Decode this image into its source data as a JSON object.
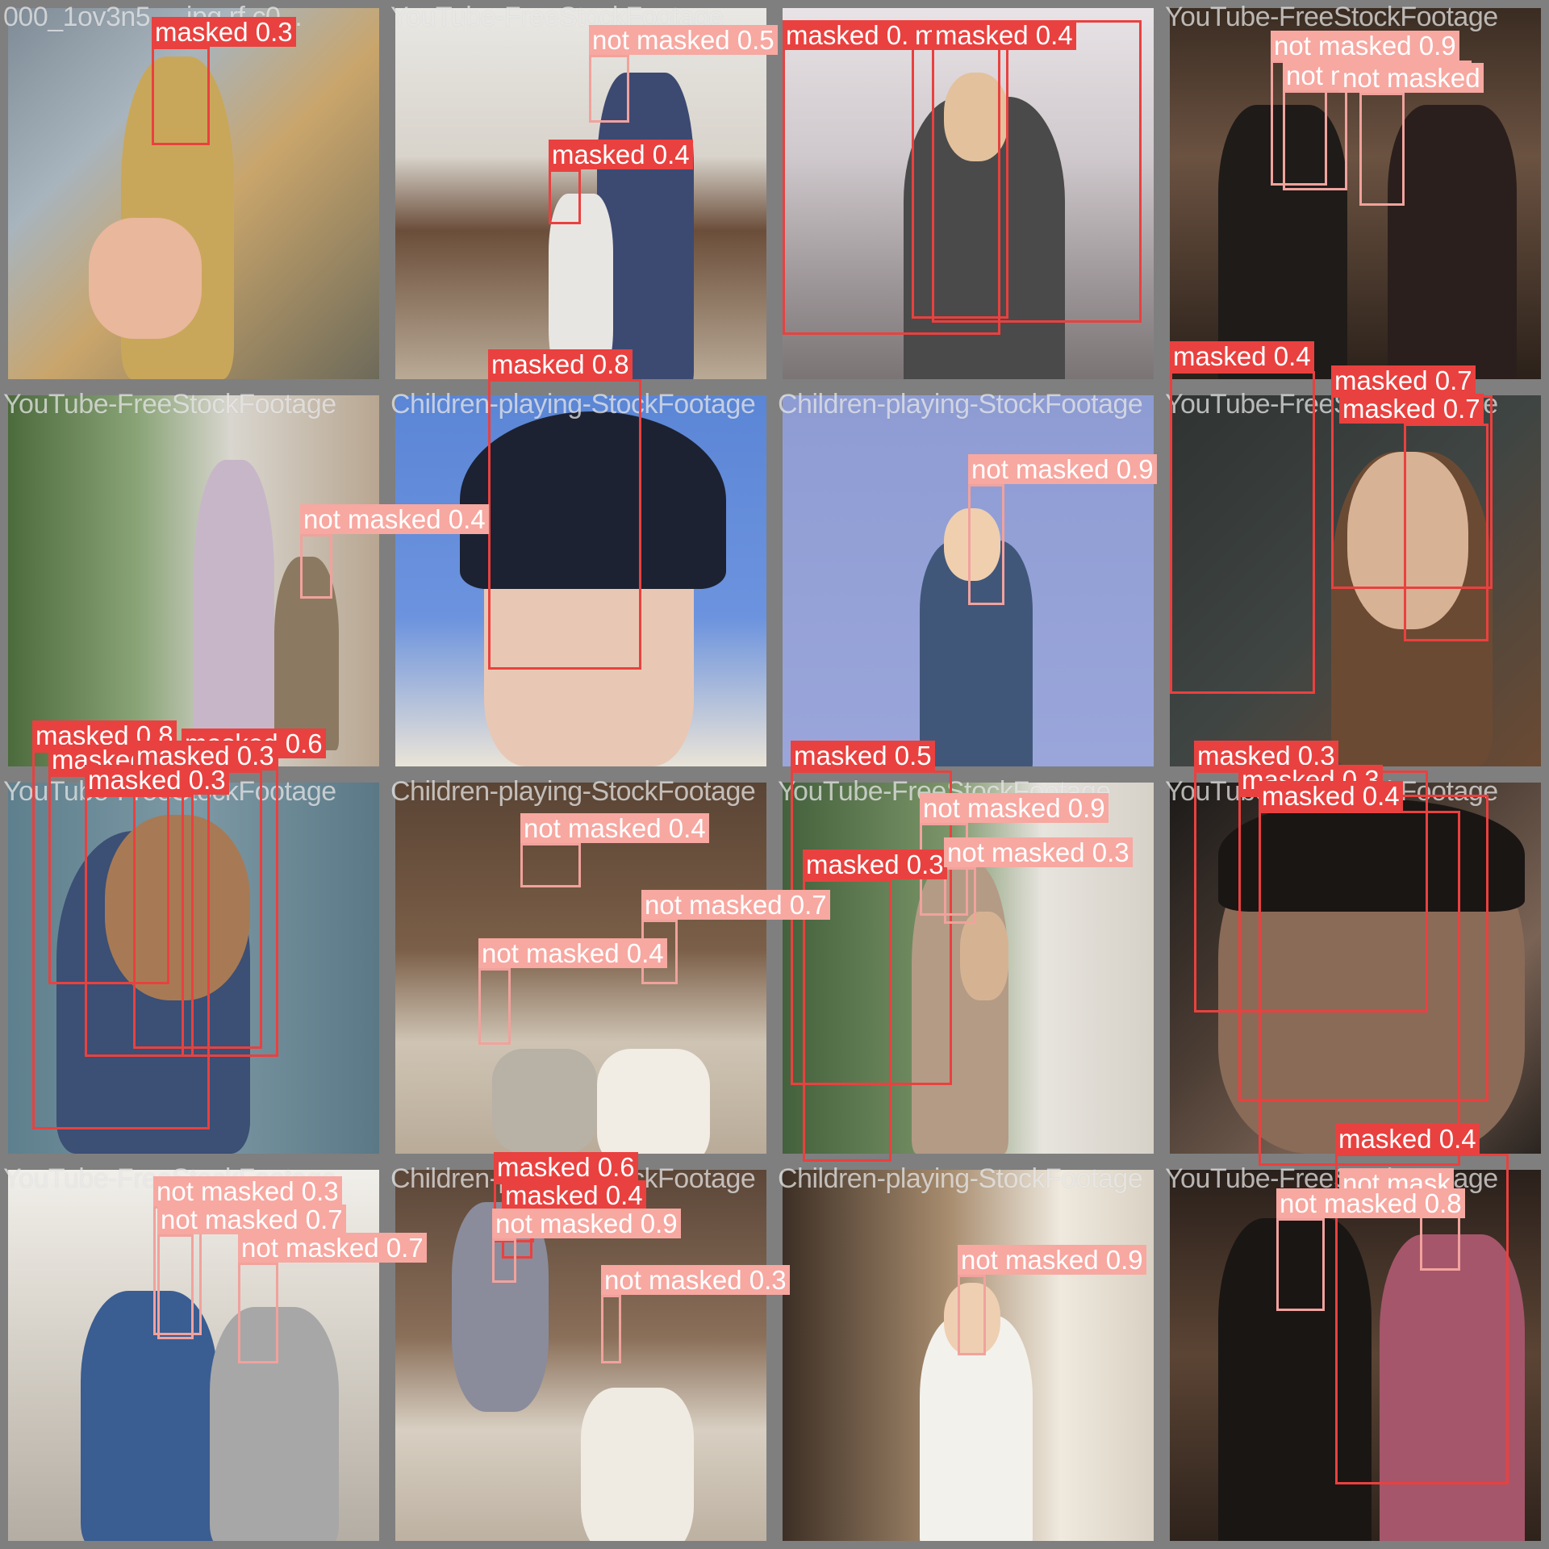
{
  "tiles": [
    {
      "filename": "000_1ov3n5... .jpg.rf.c0...",
      "boxes": [
        {
          "label": "masked 0.3",
          "cls": "m"
        }
      ]
    },
    {
      "filename": "YouTube-FreeStockFootage",
      "boxes": [
        {
          "label": "not masked 0.5",
          "cls": "nm"
        },
        {
          "label": "masked 0.4",
          "cls": "m"
        }
      ]
    },
    {
      "filename": "",
      "boxes": [
        {
          "label": "masked 0.",
          "cls": "m"
        },
        {
          "label": "masked 0.",
          "cls": "m"
        },
        {
          "label": "masked 0.4",
          "cls": "m"
        }
      ]
    },
    {
      "filename": "YouTube-FreeStockFootage",
      "boxes": [
        {
          "label": "not masked 0.9",
          "cls": "nm"
        },
        {
          "label": "not masked 0.6",
          "cls": "nm"
        },
        {
          "label": "not masked",
          "cls": "nm"
        }
      ]
    },
    {
      "filename": "YouTube-FreeStockFootage",
      "boxes": [
        {
          "label": "masked 0.8",
          "cls": "m"
        },
        {
          "label": "masked 0.6",
          "cls": "m"
        },
        {
          "label": "not masked 0.4",
          "cls": "nm"
        }
      ]
    },
    {
      "filename": "Children-playing-StockFootage",
      "boxes": [
        {
          "label": "masked 0.8",
          "cls": "m"
        }
      ]
    },
    {
      "filename": "Children-playing-StockFootage",
      "boxes": [
        {
          "label": "not masked 0.9",
          "cls": "nm"
        }
      ]
    },
    {
      "filename": "YouTube-FreeStockFootage",
      "boxes": [
        {
          "label": "masked 0.4",
          "cls": "m"
        },
        {
          "label": "masked 0.7",
          "cls": "m"
        },
        {
          "label": "masked 0.7",
          "cls": "m"
        }
      ]
    },
    {
      "filename": "YouTube-FreeStockFootage",
      "boxes": [
        {
          "label": "masked 0.3",
          "cls": "m"
        },
        {
          "label": "masked 0.3",
          "cls": "m"
        },
        {
          "label": "masked 0.3",
          "cls": "m"
        }
      ]
    },
    {
      "filename": "Children-playing-StockFootage",
      "boxes": [
        {
          "label": "not masked 0.4",
          "cls": "nm"
        },
        {
          "label": "not masked 0.7",
          "cls": "nm"
        },
        {
          "label": "not masked 0.4",
          "cls": "nm"
        }
      ]
    },
    {
      "filename": "YouTube-FreeStockFootage",
      "boxes": [
        {
          "label": "masked 0.5",
          "cls": "m"
        },
        {
          "label": "not masked 0.9",
          "cls": "nm"
        },
        {
          "label": "masked 0.3",
          "cls": "m"
        },
        {
          "label": "not masked 0.3",
          "cls": "nm"
        }
      ]
    },
    {
      "filename": "YouTube-FreeStockFootage",
      "boxes": [
        {
          "label": "masked 0.3",
          "cls": "m"
        },
        {
          "label": "masked 0.3",
          "cls": "m"
        },
        {
          "label": "masked 0.4",
          "cls": "m"
        }
      ]
    },
    {
      "filename": "YouTube-FreeStockFootage",
      "boxes": [
        {
          "label": "not masked 0.3",
          "cls": "nm"
        },
        {
          "label": "not masked 0.7",
          "cls": "nm"
        },
        {
          "label": "not masked 0.7",
          "cls": "nm"
        }
      ]
    },
    {
      "filename": "Children-playing-StockFootage",
      "boxes": [
        {
          "label": "masked 0.6",
          "cls": "m"
        },
        {
          "label": "masked 0.4",
          "cls": "m"
        },
        {
          "label": "not masked 0.3",
          "cls": "nm"
        },
        {
          "label": "not masked 0.9",
          "cls": "nm"
        }
      ]
    },
    {
      "filename": "Children-playing-StockFootage",
      "boxes": [
        {
          "label": "not masked 0.9",
          "cls": "nm"
        }
      ]
    },
    {
      "filename": "YouTube-FreeStockFootage",
      "boxes": [
        {
          "label": "masked 0.4",
          "cls": "m"
        },
        {
          "label": "not mask",
          "cls": "nm"
        },
        {
          "label": "not masked 0.8",
          "cls": "nm"
        }
      ]
    }
  ],
  "colors": {
    "masked": "#e9413f",
    "not_masked": "#f7a8a1"
  }
}
